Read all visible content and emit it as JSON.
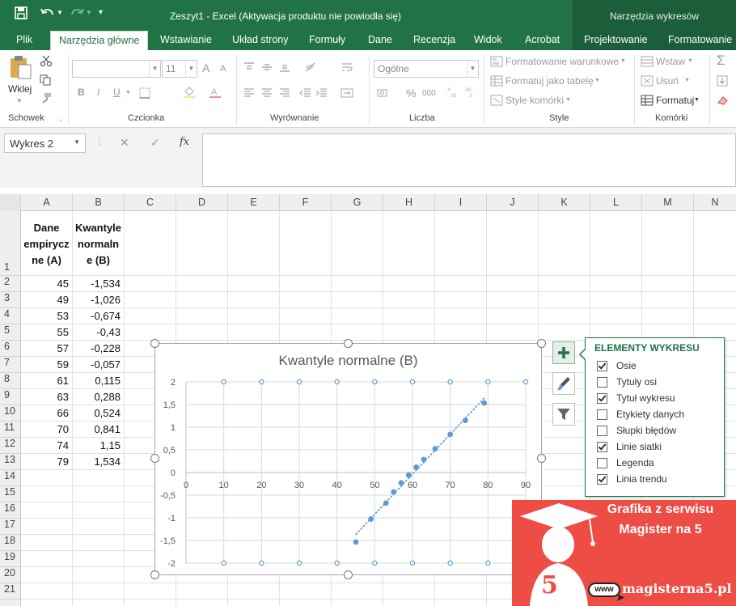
{
  "titlebar": {
    "title": "Zeszyt1 - Excel (Aktywacja produktu nie powiodła się)",
    "context_title": "Narzędzia wykresów"
  },
  "tabs": [
    "Plik",
    "Narzędzia główne",
    "Wstawianie",
    "Układ strony",
    "Formuły",
    "Dane",
    "Recenzja",
    "Widok",
    "Acrobat",
    "Projektowanie",
    "Formatowanie"
  ],
  "ribbon": {
    "clipboard": {
      "paste": "Wklej",
      "label": "Schowek"
    },
    "font": {
      "label": "Czcionka",
      "size": "11",
      "bold": "B",
      "italic": "I",
      "underline": "U",
      "grow": "A",
      "shrink": "A"
    },
    "alignment": {
      "label": "Wyrównanie"
    },
    "number": {
      "label": "Liczba",
      "format": "Ogólne",
      "percent": "%",
      "thousands": "000"
    },
    "styles": {
      "label": "Style",
      "conditional": "Formatowanie warunkowe",
      "as_table": "Formatuj jako tabelę",
      "cell_styles": "Style komórki"
    },
    "cells": {
      "label": "Komórki",
      "insert": "Wstaw",
      "delete": "Usuń",
      "format": "Formatuj"
    },
    "editing": {
      "sum": "Σ"
    }
  },
  "formula_bar": {
    "name_box": "Wykres 2",
    "fx": "fx",
    "formula": ""
  },
  "columns": [
    "A",
    "B",
    "C",
    "D",
    "E",
    "F",
    "G",
    "H",
    "I",
    "J",
    "K",
    "L",
    "M",
    "N"
  ],
  "rows": [
    "1",
    "2",
    "3",
    "4",
    "5",
    "6",
    "7",
    "8",
    "9",
    "10",
    "11",
    "12",
    "13",
    "14",
    "15",
    "16",
    "17",
    "18",
    "19",
    "20",
    "21"
  ],
  "sheet": {
    "header_a": [
      "Dane",
      "empirycz",
      "ne (A)"
    ],
    "header_b": [
      "Kwantyle",
      "normaln",
      "e (B)"
    ],
    "col_a": [
      "45",
      "49",
      "53",
      "55",
      "57",
      "59",
      "61",
      "63",
      "66",
      "70",
      "74",
      "79"
    ],
    "col_b": [
      "-1,534",
      "-1,026",
      "-0,674",
      "-0,43",
      "-0,228",
      "-0,057",
      "0,115",
      "0,288",
      "0,524",
      "0,841",
      "1,15",
      "1,534"
    ]
  },
  "chart_data": {
    "type": "scatter",
    "title": "Kwantyle normalne (B)",
    "x": [
      45,
      49,
      53,
      55,
      57,
      59,
      61,
      63,
      66,
      70,
      74,
      79
    ],
    "y": [
      -1.534,
      -1.026,
      -0.674,
      -0.43,
      -0.228,
      -0.057,
      0.115,
      0.288,
      0.524,
      0.841,
      1.15,
      1.534
    ],
    "xlim": [
      0,
      90
    ],
    "ylim": [
      -2,
      2
    ],
    "x_ticks": [
      "0",
      "10",
      "20",
      "30",
      "40",
      "50",
      "60",
      "70",
      "80",
      "90"
    ],
    "y_ticks": [
      "2",
      "1,5",
      "1",
      "0,5",
      "0",
      "-0,5",
      "-1",
      "-1,5",
      "-2"
    ],
    "grid": true,
    "trendline": "linear dotted",
    "point_color": "#5b9bd5"
  },
  "chart_elements": {
    "title": "ELEMENTY WYKRESU",
    "items": [
      {
        "label": "Osie",
        "checked": true
      },
      {
        "label": "Tytuły osi",
        "checked": false
      },
      {
        "label": "Tytuł wykresu",
        "checked": true
      },
      {
        "label": "Etykiety danych",
        "checked": false
      },
      {
        "label": "Słupki błędów",
        "checked": false
      },
      {
        "label": "Linie siatki",
        "checked": true
      },
      {
        "label": "Legenda",
        "checked": false
      },
      {
        "label": "Linia trendu",
        "checked": true
      }
    ]
  },
  "watermark": {
    "line1": "Grafika z serwisu",
    "line2": "Magister na 5",
    "badge": "5",
    "www": "www",
    "url": "magisterna5.pl"
  },
  "colors": {
    "excel_green": "#217346",
    "series_blue": "#5b9bd5",
    "watermark_red": "#ee4d45"
  }
}
